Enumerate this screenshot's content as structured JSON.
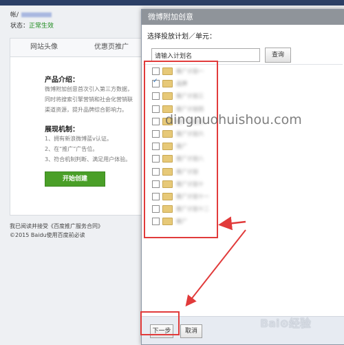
{
  "account": {
    "label": "帐/",
    "status_label": "状态：",
    "status_value": "正常生效"
  },
  "background": {
    "tabs": [
      "网站头像",
      "优惠页推广"
    ],
    "intro_title": "产品介绍：",
    "intro_lines": [
      "微博附加创意首次引入第三方数据，",
      "同时将搜索引擎营销和社会化营销联",
      "渠道资源，提升品牌综合影响力。"
    ],
    "display_title": "展现机制：",
    "display_lines": [
      "1、拥有新浪微博蓝v认证。",
      "2、在“推广”广告位。",
      "3、符合机制判断、满足用户体验。"
    ],
    "start_button": "开始创建",
    "footer_line1": "我已阅读并接受《百度推广服务合同》",
    "footer_line2": "©2015 Baidu使用百度前必读"
  },
  "dialog": {
    "title": "微博附加创意",
    "label": "选择投放计划／单元：",
    "search": {
      "placeholder": "请输入计划名",
      "value": "请输入计划名"
    },
    "query_button": "查询",
    "plans": [
      {
        "name": "推广计划一",
        "checked": false
      },
      {
        "name": "品牌",
        "checked": true
      },
      {
        "name": "推广计划三",
        "checked": false
      },
      {
        "name": "推广计划四",
        "checked": false
      },
      {
        "name": "推广计划五",
        "checked": false
      },
      {
        "name": "推广计划六",
        "checked": false
      },
      {
        "name": "推广",
        "checked": false
      },
      {
        "name": "推广计划八",
        "checked": false
      },
      {
        "name": "推广计划",
        "checked": false
      },
      {
        "name": "推广计划十",
        "checked": false
      },
      {
        "name": "推广计划十一",
        "checked": false
      },
      {
        "name": "推广计划十二",
        "checked": false
      },
      {
        "name": "推广",
        "checked": false
      }
    ],
    "next_button": "下一步",
    "cancel_button": "取消"
  },
  "watermark": "dingnuohuishou.com",
  "baidu_logo": "Bai⊙经验",
  "colors": {
    "annotation": "#e13a3a",
    "status_green": "#1c8a1c",
    "button_green": "#4a9f28"
  }
}
